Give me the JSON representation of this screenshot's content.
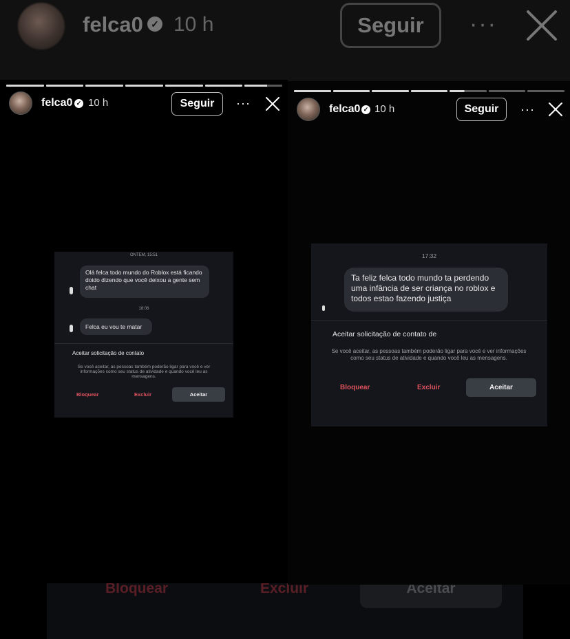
{
  "background_header": {
    "username": "felca0",
    "time": "10 h",
    "follow_label": "Seguir",
    "more_label": "···"
  },
  "background_bottom": {
    "block_label": "Bloquear",
    "delete_label": "Excluir",
    "accept_label": "Aceitar"
  },
  "left_story": {
    "username": "felca0",
    "time": "10 h",
    "follow_label": "Seguir",
    "more_label": "···",
    "progress_segments": 7,
    "progress_current": 7,
    "progress_current_fill": 0.6,
    "screenshot": {
      "stamp_top": "ONTEM, 15:51",
      "message1": "Olá felca todo mundo do Roblox está ficando doido dizendo que você deixou a gente sem chat",
      "stamp_mid": "18:06",
      "message2": "Felca eu vou te matar",
      "request_title": "Aceitar solicitação de contato",
      "request_note": "Se você aceitar, as pessoas também poderão ligar para você e ver informações como seu status de atividade e quando você leu as mensagens.",
      "block_label": "Bloquear",
      "delete_label": "Excluir",
      "accept_label": "Aceitar"
    }
  },
  "right_story": {
    "username": "felca0",
    "time": "10 h",
    "follow_label": "Seguir",
    "more_label": "···",
    "progress_segments": 7,
    "progress_current": 5,
    "progress_current_fill": 0.4,
    "screenshot": {
      "stamp_top": "17:32",
      "message1": "Ta feliz felca todo mundo ta perdendo uma infância de ser criança no roblox e todos estao fazendo justiça",
      "request_title": "Aceitar solicitação de contato de",
      "request_note": "Se você aceitar, as pessoas também poderão ligar para você e ver informações como seu status de atividade e quando você leu as mensagens.",
      "block_label": "Bloquear",
      "delete_label": "Excluir",
      "accept_label": "Aceitar"
    }
  }
}
